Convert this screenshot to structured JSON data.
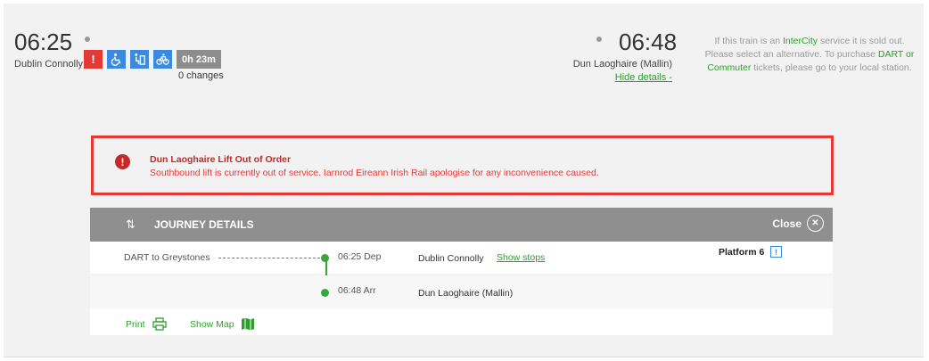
{
  "journey": {
    "departure_time": "06:25",
    "departure_station": "Dublin Connolly",
    "duration": "0h 23m",
    "changes": "0 changes",
    "arrival_time": "06:48",
    "arrival_station": "Dun Laoghaire (Mallin)",
    "hide_details": "Hide details -"
  },
  "icons": [
    "alert-icon",
    "wheelchair-icon",
    "lift-icon",
    "bicycle-icon"
  ],
  "notice": {
    "p1": "If this train is an ",
    "intercity": "InterCity",
    "p2": " service it is sold out. Please select an alternative. To purchase ",
    "dart": "DART or Commuter",
    "p3": " tickets, please go to your local station."
  },
  "alert": {
    "title": "Dun Laoghaire Lift Out of Order",
    "body": "Southbound lift is currently out of service. Iarnrod Eireann Irish Rail apologise for any inconvenience caused."
  },
  "journey_details": {
    "title": "JOURNEY DETAILS",
    "close": "Close",
    "train": "DART to Greystones",
    "stops": [
      {
        "time": "06:25 Dep",
        "station": "Dublin Connolly"
      },
      {
        "time": "06:48 Arr",
        "station": "Dun Laoghaire (Mallin)"
      }
    ],
    "show_stops": "Show stops",
    "platform": "Platform 6",
    "print": "Print",
    "show_map": "Show Map"
  },
  "colors": {
    "accent_green": "#2e9e2e",
    "alert_red": "#e53935",
    "icon_blue": "#3a8be0",
    "header_gray": "#8f8f8f"
  }
}
